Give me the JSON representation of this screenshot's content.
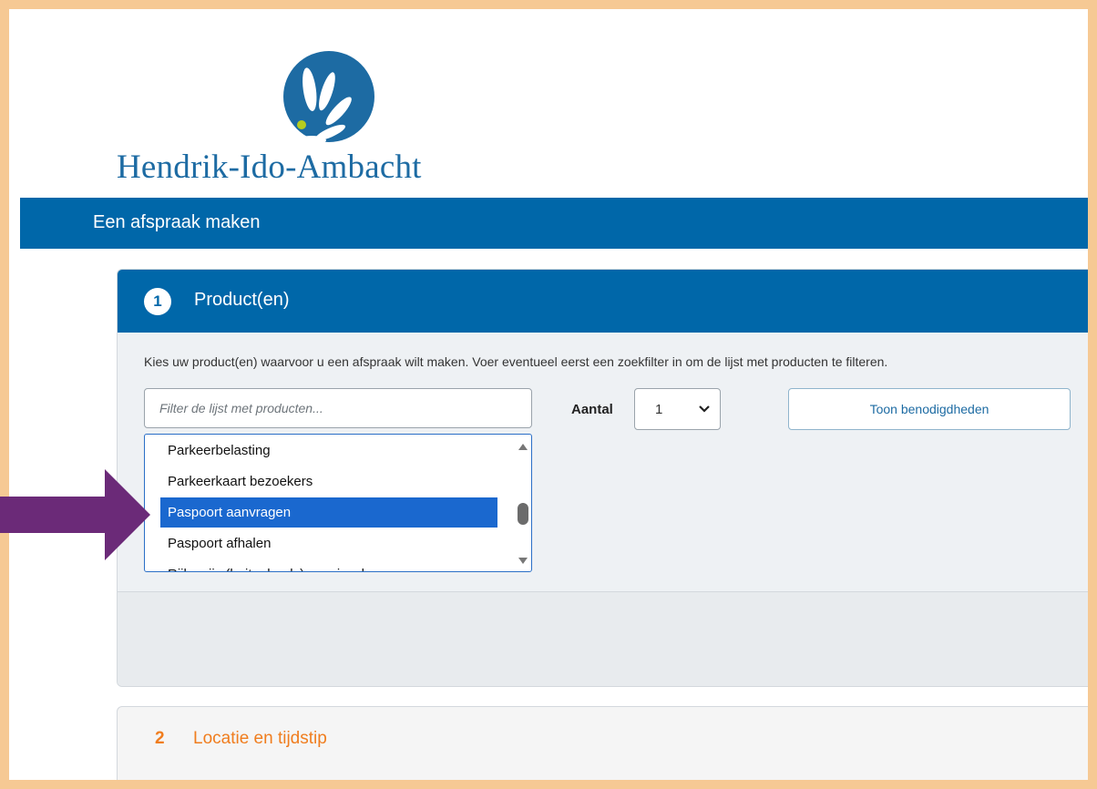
{
  "logo": {
    "name": "Hendrik-Ido-Ambacht"
  },
  "header": {
    "title": "Een afspraak maken"
  },
  "step1": {
    "number": "1",
    "title": "Product(en)",
    "intro": "Kies uw product(en) waarvoor u een afspraak wilt maken. Voer eventueel eerst een zoekfilter in om de lijst met producten te filteren.",
    "filter_placeholder": "Filter de lijst met producten...",
    "filter_value": "",
    "aantal_label": "Aantal",
    "aantal_value": "1",
    "toon_button": "Toon benodigdheden",
    "list_items": [
      "Parkeerbelasting",
      "Parkeerkaart bezoekers",
      "Paspoort aanvragen",
      "Paspoort afhalen",
      "Rijbewijs (buitenlands) omwisselen"
    ],
    "selected_item": "Paspoort aanvragen"
  },
  "step2": {
    "number": "2",
    "title": "Locatie en tijdstip"
  },
  "colors": {
    "brand_blue": "#0067a9",
    "accent_orange": "#f07d1e",
    "selection": "#1a68cf",
    "frame": "#f6c994",
    "annotation_arrow": "#6b2a78"
  },
  "icons": {
    "logo": "flower-logo-icon",
    "select_chevron": "chevron-down-icon",
    "annotation": "arrow-right-icon"
  }
}
